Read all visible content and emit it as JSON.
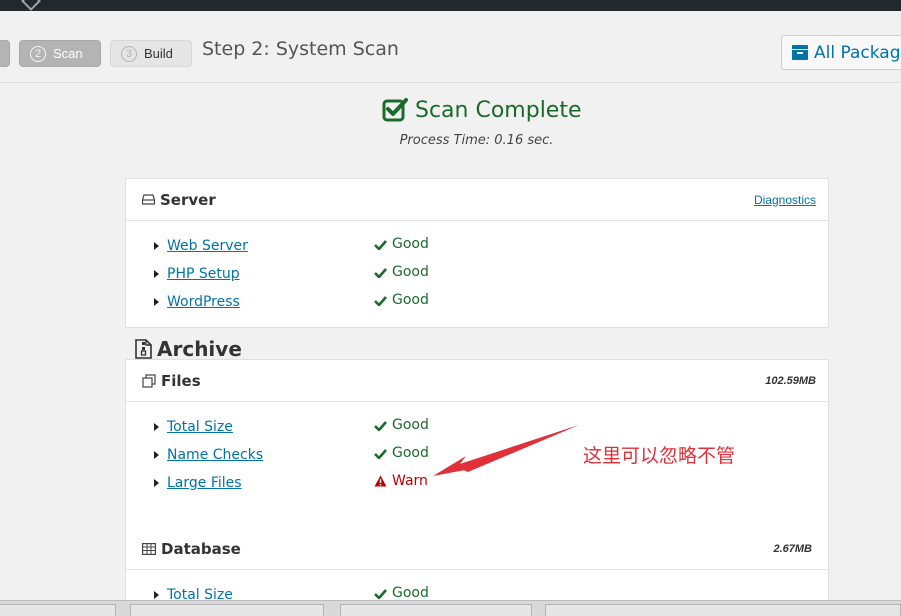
{
  "header": {
    "steps": [
      {
        "label": "",
        "num": ""
      },
      {
        "label": "Scan",
        "num": "2"
      },
      {
        "label": "Build",
        "num": "3"
      }
    ],
    "step_title": "Step 2: System Scan",
    "all_packages_label": "All Packages"
  },
  "status": {
    "title": "Scan Complete",
    "process_time": "Process Time: 0.16 sec."
  },
  "server": {
    "title": "Server",
    "link": "Diagnostics",
    "rows": [
      {
        "name": "Web Server",
        "status": "Good"
      },
      {
        "name": "PHP Setup",
        "status": "Good"
      },
      {
        "name": "WordPress",
        "status": "Good"
      }
    ]
  },
  "archive": {
    "title": "Archive",
    "files": {
      "title": "Files",
      "size": "102.59MB",
      "rows": [
        {
          "name": "Total Size",
          "status": "Good"
        },
        {
          "name": "Name Checks",
          "status": "Good"
        },
        {
          "name": "Large Files",
          "status": "Warn"
        }
      ]
    },
    "database": {
      "title": "Database",
      "size": "2.67MB",
      "rows": [
        {
          "name": "Total Size",
          "status": "Good"
        }
      ]
    }
  },
  "annotation": {
    "text": "这里可以忽略不管",
    "color": "#e0313a"
  },
  "colors": {
    "good": "#1a6a2b",
    "warn": "#c10000",
    "link": "#0073aa"
  }
}
